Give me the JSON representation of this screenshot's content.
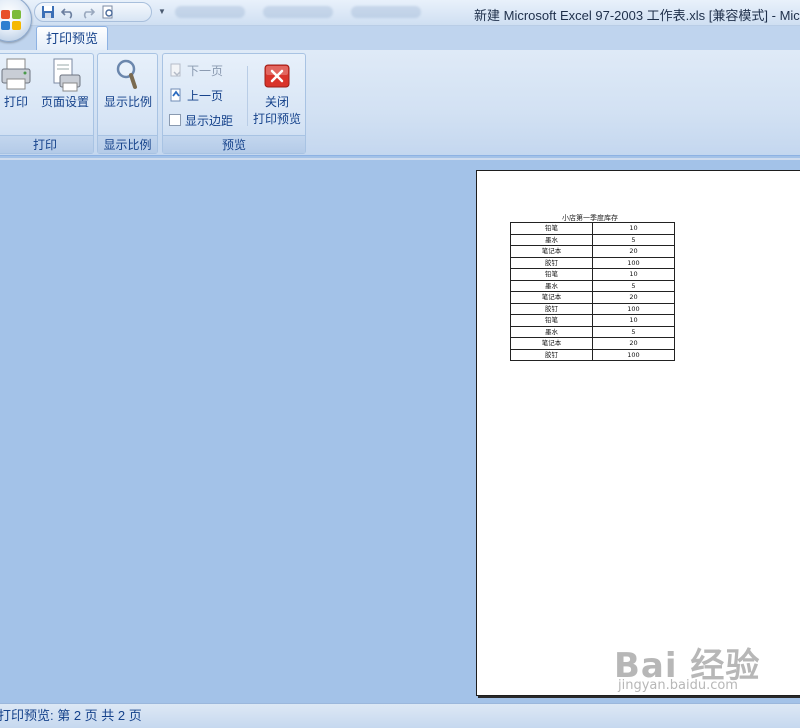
{
  "window": {
    "title": "新建 Microsoft Excel 97-2003 工作表.xls  [兼容模式] - Mic"
  },
  "ribbon": {
    "active_tab": "打印预览",
    "groups": {
      "print": {
        "label": "打印",
        "buttons": {
          "print": "打印",
          "page_setup": "页面设置"
        }
      },
      "zoom": {
        "label": "显示比例",
        "buttons": {
          "zoom": "显示比例"
        }
      },
      "preview": {
        "label": "预览",
        "buttons": {
          "next_page": "下一页",
          "prev_page": "上一页",
          "show_margins": "显示边距",
          "close_line1": "关闭",
          "close_line2": "打印预览"
        }
      }
    }
  },
  "sheet": {
    "title": "小店第一季度库存",
    "rows": [
      [
        "铅笔",
        "10"
      ],
      [
        "墨水",
        "5"
      ],
      [
        "笔记本",
        "20"
      ],
      [
        "胶钉",
        "100"
      ],
      [
        "铅笔",
        "10"
      ],
      [
        "墨水",
        "5"
      ],
      [
        "笔记本",
        "20"
      ],
      [
        "胶钉",
        "100"
      ],
      [
        "铅笔",
        "10"
      ],
      [
        "墨水",
        "5"
      ],
      [
        "笔记本",
        "20"
      ],
      [
        "胶钉",
        "100"
      ]
    ]
  },
  "status": {
    "text": "打印预览: 第 2 页  共 2 页"
  },
  "watermark": {
    "main": "Bai 经验",
    "sub": "jingyan.baidu.com"
  },
  "colors": {
    "workspace": "#a3c2e8",
    "ribbon_text": "#15428b",
    "close_button": "#d9342b"
  }
}
